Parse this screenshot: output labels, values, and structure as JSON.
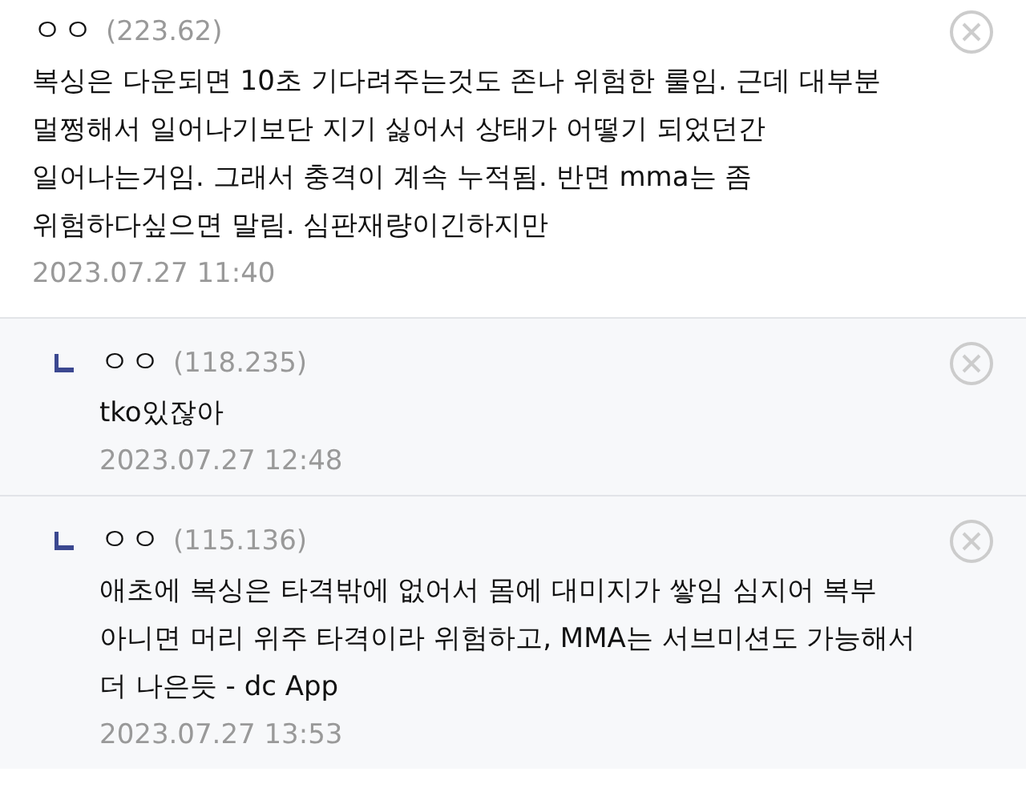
{
  "comments": [
    {
      "kind": "comment",
      "nickname": "ㅇㅇ",
      "ip": "(223.62)",
      "body": "복싱은 다운되면 10초 기다려주는것도 존나 위험한 룰임. 근데 대부분 멀쩡해서 일어나기보단 지기 싫어서 상태가 어떻기 되었던간 일어나는거임. 그래서 충격이 계속 누적됨. 반면 mma는 좀 위험하다싶으면 말림. 심판재량이긴하지만",
      "date": "2023.07.27 11:40"
    },
    {
      "kind": "reply",
      "nickname": "ㅇㅇ",
      "ip": "(118.235)",
      "body": "tko있잖아",
      "date": "2023.07.27 12:48"
    },
    {
      "kind": "reply",
      "nickname": "ㅇㅇ",
      "ip": "(115.136)",
      "body": "애초에 복싱은 타격밖에 없어서 몸에 대미지가 쌓임 심지어 복부 아니면 머리 위주 타격이라 위험하고, MMA는 서브미션도 가능해서 더 나은듯 - dc App",
      "date": "2023.07.27 13:53"
    }
  ]
}
